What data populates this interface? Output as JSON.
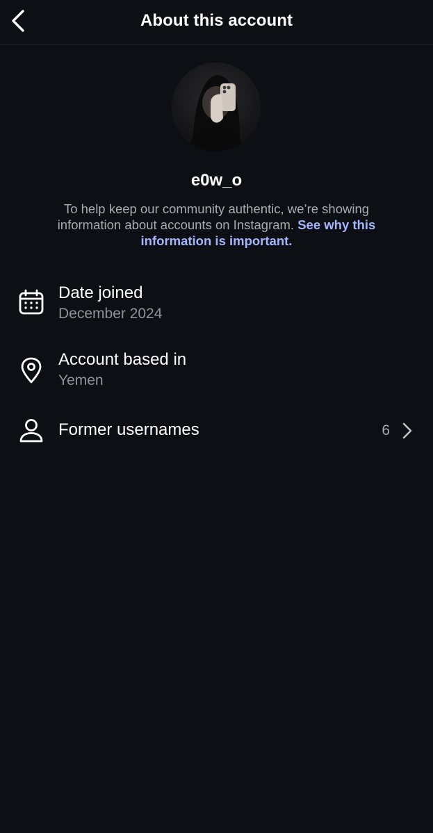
{
  "header": {
    "title": "About this account"
  },
  "profile": {
    "username": "e0w_o",
    "explanation": "To help keep our community authentic, we’re showing information about accounts on Instagram.",
    "link_text": "See why this information is important."
  },
  "details": {
    "date_joined": {
      "label": "Date joined",
      "value": "December 2024",
      "icon": "calendar-icon"
    },
    "based_in": {
      "label": "Account based in",
      "value": "Yemen",
      "icon": "location-pin-icon"
    },
    "former_usernames": {
      "label": "Former usernames",
      "count": "6",
      "icon": "person-icon"
    }
  },
  "colors": {
    "background": "#0c1014",
    "link": "#a5b4fc",
    "secondary_text": "#8e9399"
  }
}
